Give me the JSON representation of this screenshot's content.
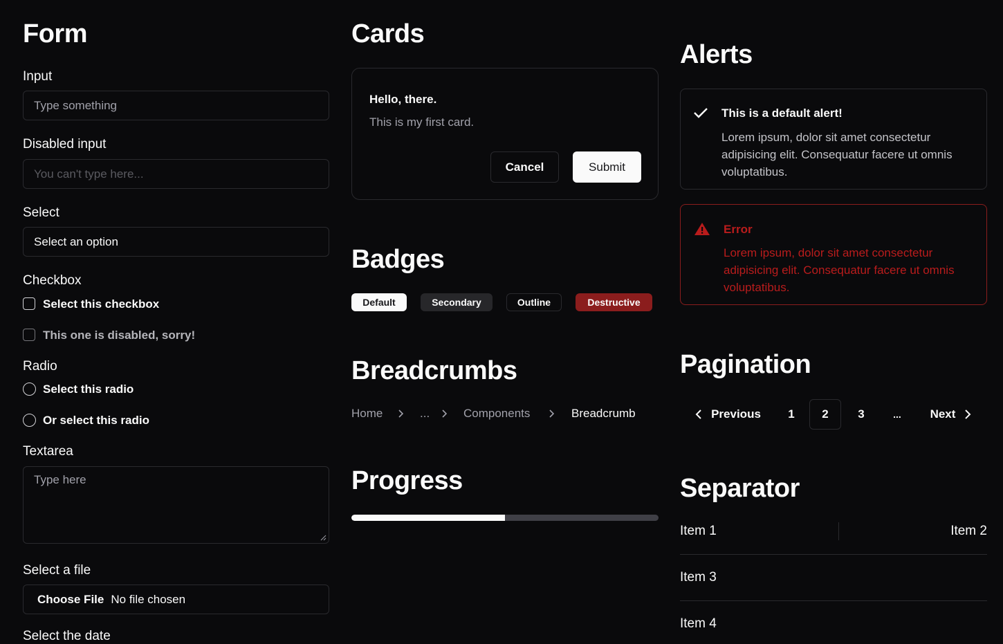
{
  "form": {
    "title": "Form",
    "input_label": "Input",
    "input_placeholder": "Type something",
    "disabled_label": "Disabled input",
    "disabled_placeholder": "You can't type here...",
    "select_label": "Select",
    "select_value": "Select an option",
    "checkbox_label": "Checkbox",
    "checkbox_option": "Select this checkbox",
    "checkbox_disabled_option": "This one is disabled, sorry!",
    "radio_label": "Radio",
    "radio_option_1": "Select this radio",
    "radio_option_2": "Or select this radio",
    "textarea_label": "Textarea",
    "textarea_placeholder": "Type here",
    "file_label": "Select a file",
    "file_button": "Choose File",
    "file_status": "No file chosen",
    "date_label": "Select the date"
  },
  "cards": {
    "title": "Cards",
    "card_title": "Hello, there.",
    "card_text": "This is my first card.",
    "cancel_label": "Cancel",
    "submit_label": "Submit"
  },
  "badges": {
    "title": "Badges",
    "items": [
      "Default",
      "Secondary",
      "Outline",
      "Destructive"
    ]
  },
  "breadcrumbs": {
    "title": "Breadcrumbs",
    "items": [
      "Home",
      "...",
      "Components",
      "Breadcrumb"
    ]
  },
  "progress": {
    "title": "Progress",
    "value_percent": 50
  },
  "alerts": {
    "title": "Alerts",
    "default_title": "This is a default alert!",
    "default_text": "Lorem ipsum, dolor sit amet consectetur adipisicing elit. Consequatur facere ut omnis voluptatibus.",
    "error_title": "Error",
    "error_text": "Lorem ipsum, dolor sit amet consectetur adipisicing elit. Consequatur facere ut omnis voluptatibus."
  },
  "pagination": {
    "title": "Pagination",
    "previous_label": "Previous",
    "pages": [
      "1",
      "2",
      "3"
    ],
    "ellipsis": "...",
    "current_page": "2",
    "next_label": "Next"
  },
  "separator": {
    "title": "Separator",
    "item1": "Item 1",
    "item2": "Item 2",
    "item3": "Item 3",
    "item4": "Item 4"
  },
  "colors": {
    "background": "#0a0a0c",
    "border": "#2a2a2e",
    "destructive": "#8b1d1d",
    "error_text": "#b91c1c"
  }
}
